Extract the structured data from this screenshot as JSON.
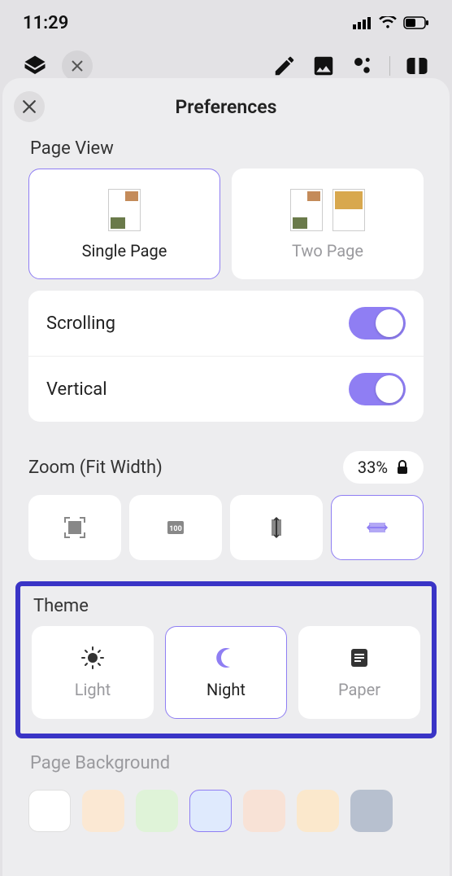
{
  "statusbar": {
    "time": "11:29"
  },
  "sheet": {
    "title": "Preferences",
    "pageview": {
      "label": "Page View",
      "options": [
        {
          "label": "Single Page",
          "selected": true
        },
        {
          "label": "Two Page",
          "selected": false
        }
      ],
      "toggles": [
        {
          "label": "Scrolling",
          "on": true
        },
        {
          "label": "Vertical",
          "on": true
        }
      ]
    },
    "zoom": {
      "label": "Zoom (Fit Width)",
      "value": "33%",
      "locked": true,
      "options": [
        "fit-page",
        "actual-size",
        "fit-height",
        "fit-width"
      ],
      "selected": 3
    },
    "theme": {
      "label": "Theme",
      "options": [
        {
          "label": "Light"
        },
        {
          "label": "Night"
        },
        {
          "label": "Paper"
        }
      ],
      "selected": 1
    },
    "background": {
      "label": "Page Background",
      "colors": [
        "#ffffff",
        "#fbe8d3",
        "#dff3d8",
        "#dfeafd",
        "#f8e2d6",
        "#fbe8cc",
        "#b7c0cf"
      ],
      "selected": 3
    }
  }
}
